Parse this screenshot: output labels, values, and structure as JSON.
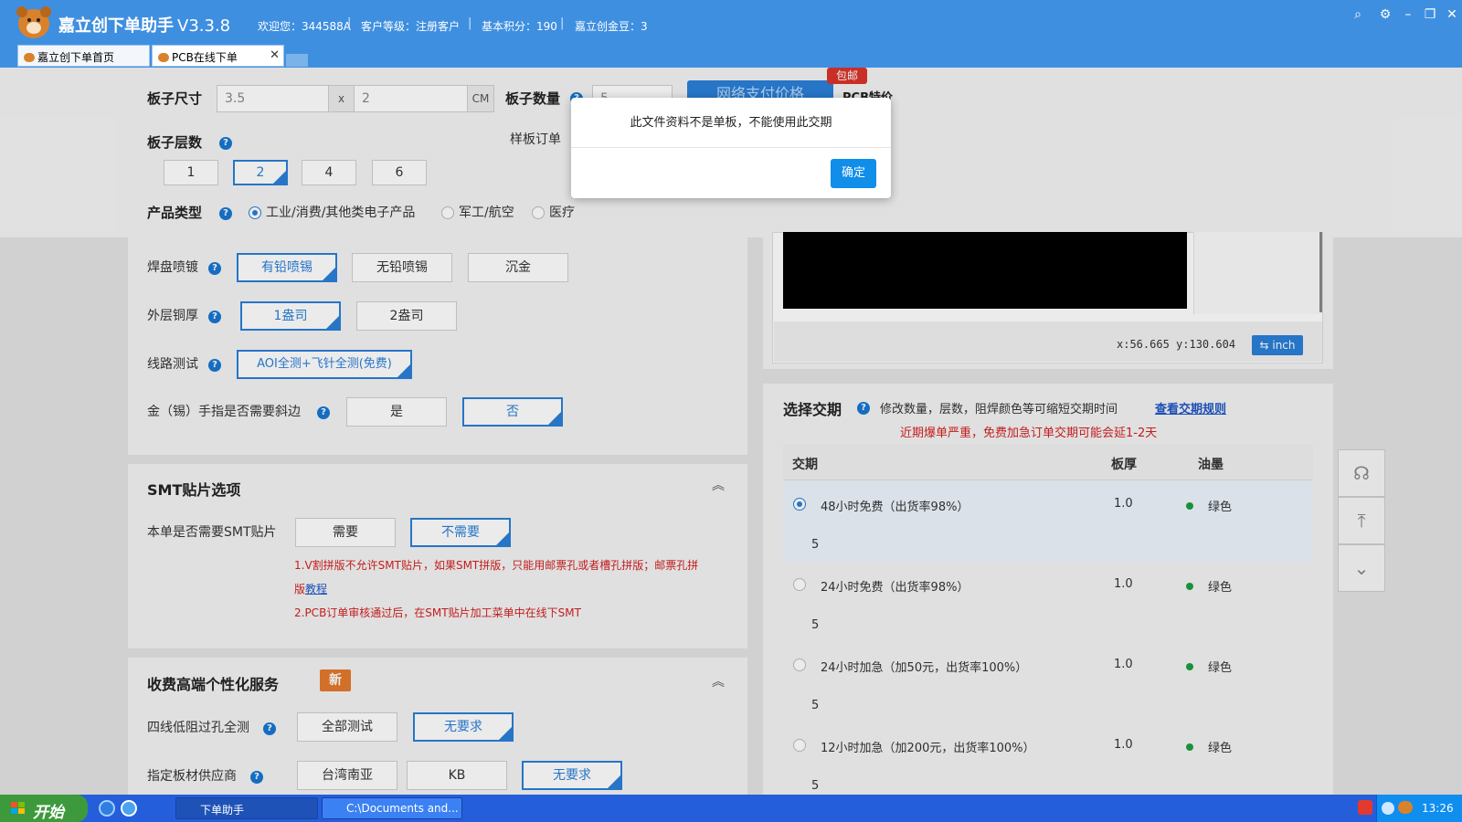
{
  "app": {
    "title": "嘉立创下单助手",
    "version": "V3.3.8",
    "welcome": "欢迎您：344588A",
    "level": "客户等级：注册客户",
    "points": "基本积分：190",
    "beans": "嘉立创金豆：3"
  },
  "tabs": [
    {
      "label": "嘉立创下单首页"
    },
    {
      "label": "PCB在线下单"
    }
  ],
  "form": {
    "board_size": {
      "label": "板子尺寸",
      "w": "3.5",
      "x": "x",
      "h": "2",
      "unit": "CM"
    },
    "board_qty": {
      "label": "板子数量",
      "value": "5"
    },
    "sample_order": "样板订单",
    "layers": {
      "label": "板子层数",
      "options": [
        "1",
        "2",
        "4",
        "6"
      ],
      "selected": "2"
    },
    "product_type": {
      "label": "产品类型",
      "options": [
        "工业/消费/其他类电子产品",
        "军工/航空",
        "医疗"
      ],
      "selected": "工业/消费/其他类电子产品"
    },
    "surface": {
      "label": "焊盘喷镀",
      "options": [
        "有铅喷锡",
        "无铅喷锡",
        "沉金"
      ],
      "selected": "有铅喷锡"
    },
    "copper": {
      "label": "外层铜厚",
      "options": [
        "1盎司",
        "2盎司"
      ],
      "selected": "1盎司"
    },
    "test": {
      "label": "线路测试",
      "value": "AOI全测+飞针全测(免费)"
    },
    "gold_finger": {
      "label": "金（锡）手指是否需要斜边",
      "options": [
        "是",
        "否"
      ],
      "selected": "否"
    }
  },
  "smt": {
    "title": "SMT贴片选项",
    "question": "本单是否需要SMT贴片",
    "options": [
      "需要",
      "不需要"
    ],
    "selected": "不需要",
    "note1a": "1.V割拼版不允许SMT贴片，如果SMT拼版，只能用邮票孔或者槽孔拼版；邮票孔拼",
    "note1b": "版",
    "note1_link": "教程",
    "note2": "2.PCB订单审核通过后，在SMT贴片加工菜单中在线下SMT"
  },
  "premium": {
    "title": "收费高端个性化服务",
    "badge": "新",
    "four_wire": {
      "label": "四线低阻过孔全测",
      "options": [
        "全部测试",
        "无要求"
      ],
      "selected": "无要求"
    },
    "supplier": {
      "label": "指定板材供应商",
      "options": [
        "台湾南亚",
        "KB",
        "无要求"
      ],
      "selected": "无要求"
    }
  },
  "promo": {
    "label": "网络支付价格",
    "baoyou": "包邮",
    "pcb_special": "PCB特价"
  },
  "preview": {
    "coords": "x:56.665 y:130.604",
    "inch_label": "⇆ inch"
  },
  "delivery": {
    "title": "选择交期",
    "hint": "修改数量，层数，阻焊颜色等可缩短交期时间",
    "link": "查看交期规则",
    "warning": "近期爆单严重，免费加急订单交期可能会延1-2天",
    "headers": [
      "交期",
      "板厚",
      "油墨"
    ],
    "rows": [
      {
        "name": "48小时免费（出货率98%）",
        "thickness": "1.0",
        "ink": "绿色",
        "qty": "5",
        "selected": true
      },
      {
        "name": "24小时免费（出货率98%）",
        "thickness": "1.0",
        "ink": "绿色",
        "qty": "5",
        "selected": false
      },
      {
        "name": "24小时加急（加50元，出货率100%）",
        "thickness": "1.0",
        "ink": "绿色",
        "qty": "5",
        "selected": false
      },
      {
        "name": "12小时加急（加200元，出货率100%）",
        "thickness": "1.0",
        "ink": "绿色",
        "qty": "5",
        "selected": false
      }
    ]
  },
  "dialog": {
    "message": "此文件资料不是单板，不能使用此交期",
    "ok": "确定"
  },
  "taskbar": {
    "start": "开始",
    "tasks": [
      "下单助手",
      "C:\\Documents and..."
    ],
    "clock": "13:26"
  }
}
